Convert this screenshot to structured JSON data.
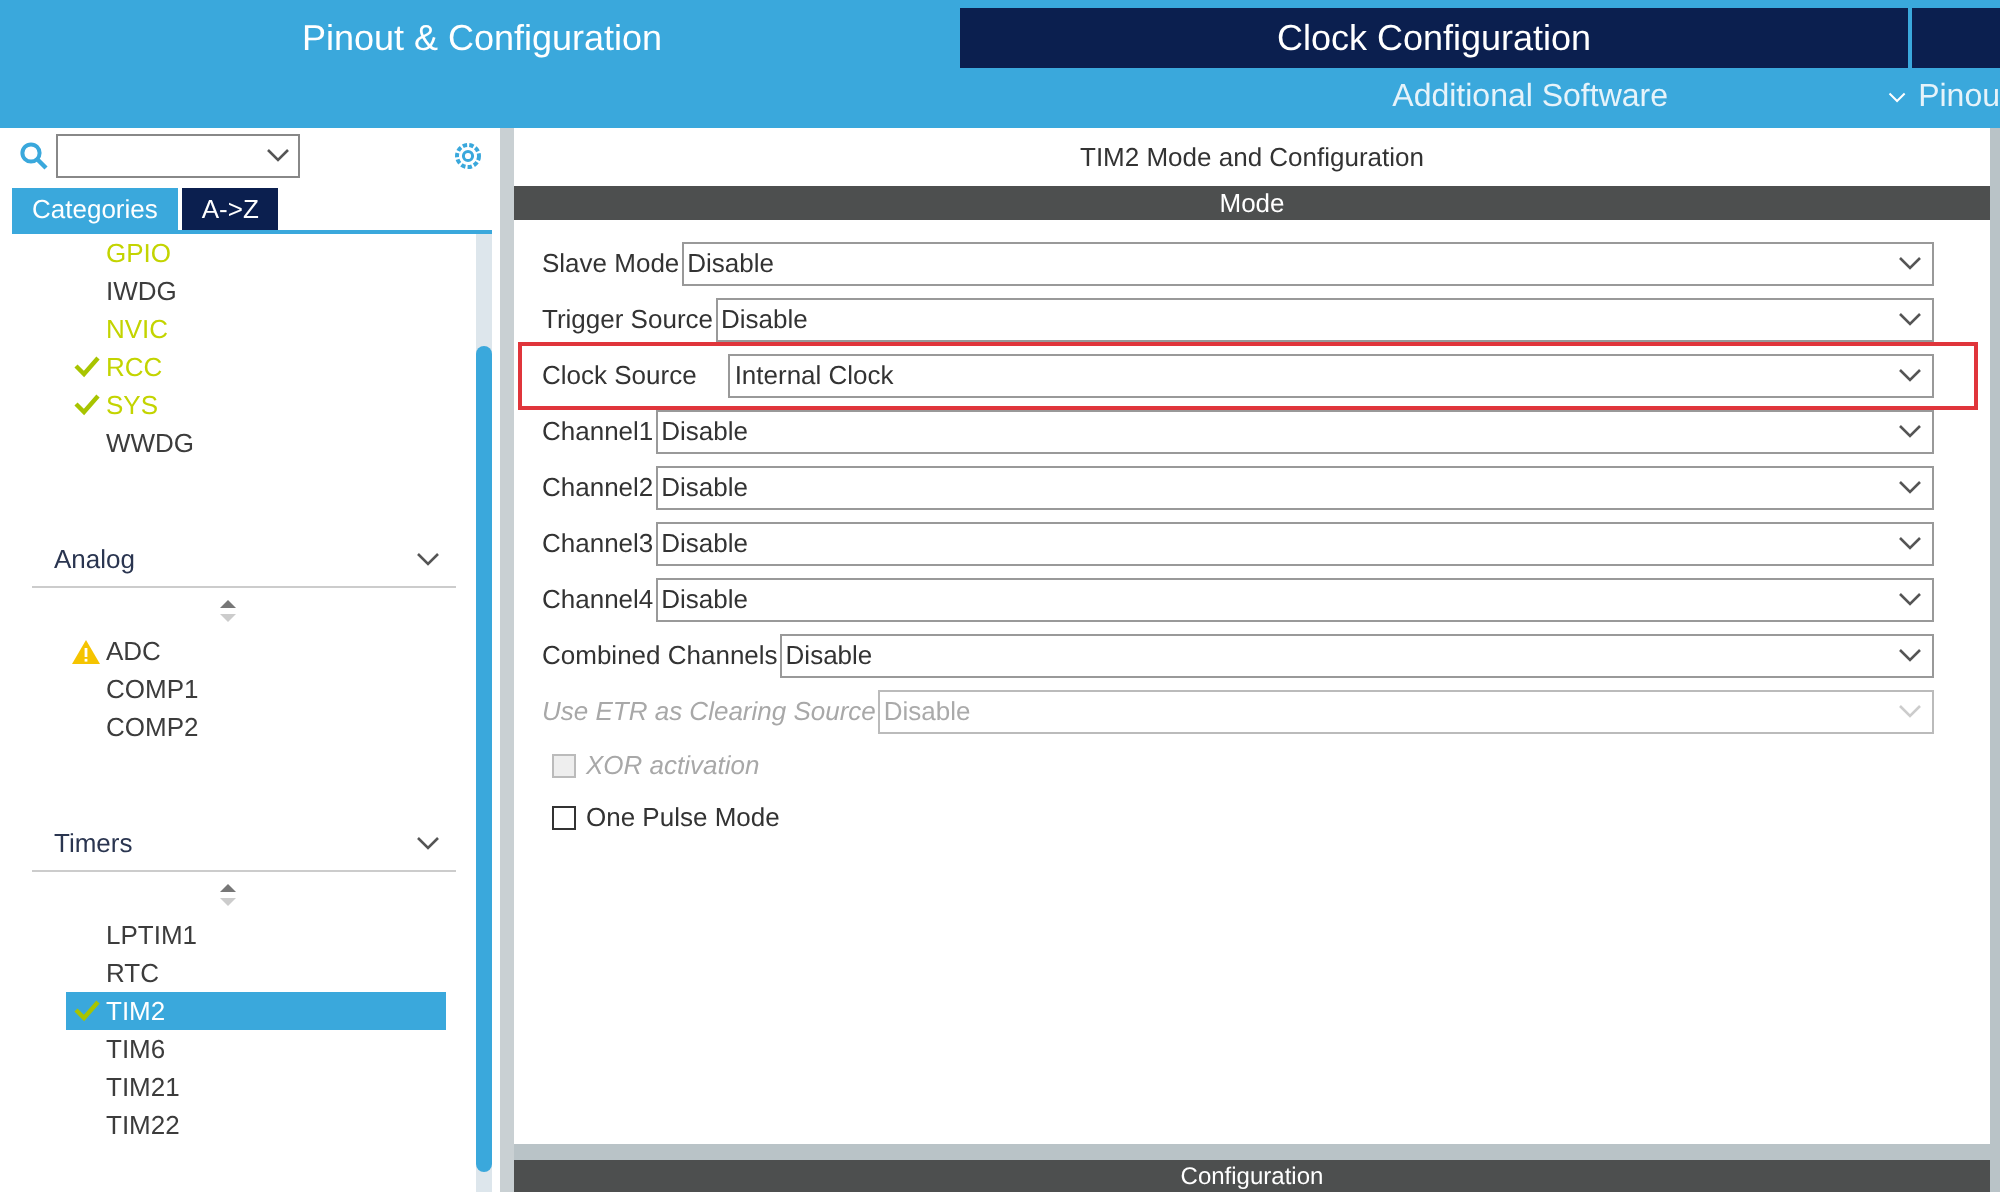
{
  "header": {
    "tabs": [
      {
        "label": "Pinout & Configuration",
        "selected": true
      },
      {
        "label": "Clock Configuration",
        "selected": false
      }
    ],
    "menus": [
      {
        "label": "Additional Software",
        "expandable": false
      },
      {
        "label": "Pinou",
        "expandable": true
      }
    ]
  },
  "sidebar": {
    "tabs": [
      {
        "label": "Categories",
        "selected": true
      },
      {
        "label": "A->Z",
        "selected": false
      }
    ],
    "groups": [
      {
        "items": [
          {
            "label": "GPIO",
            "active": true,
            "kind": "plain",
            "selected": false
          },
          {
            "label": "IWDG",
            "active": false,
            "kind": "plain",
            "selected": false
          },
          {
            "label": "NVIC",
            "active": true,
            "kind": "plain",
            "selected": false
          },
          {
            "label": "RCC",
            "active": true,
            "kind": "checked",
            "selected": false
          },
          {
            "label": "SYS",
            "active": true,
            "kind": "checked",
            "selected": false
          },
          {
            "label": "WWDG",
            "active": false,
            "kind": "plain",
            "selected": false
          }
        ]
      },
      {
        "title": "Analog",
        "expanded": true,
        "items": [
          {
            "label": "ADC",
            "active": false,
            "kind": "warning",
            "selected": false
          },
          {
            "label": "COMP1",
            "active": false,
            "kind": "plain",
            "selected": false
          },
          {
            "label": "COMP2",
            "active": false,
            "kind": "plain",
            "selected": false
          }
        ]
      },
      {
        "title": "Timers",
        "expanded": true,
        "items": [
          {
            "label": "LPTIM1",
            "active": false,
            "kind": "plain",
            "selected": false
          },
          {
            "label": "RTC",
            "active": false,
            "kind": "plain",
            "selected": false
          },
          {
            "label": "TIM2",
            "active": false,
            "kind": "checked",
            "selected": true
          },
          {
            "label": "TIM6",
            "active": false,
            "kind": "plain",
            "selected": false
          },
          {
            "label": "TIM21",
            "active": false,
            "kind": "plain",
            "selected": false
          },
          {
            "label": "TIM22",
            "active": false,
            "kind": "plain",
            "selected": false
          }
        ]
      }
    ]
  },
  "panel": {
    "title": "TIM2 Mode and Configuration",
    "mode_bar": "Mode",
    "config_bar": "Configuration",
    "fields": [
      {
        "kind": "select",
        "label": "Slave Mode",
        "value": "Disable",
        "disabled": false,
        "highlighted": false
      },
      {
        "kind": "select",
        "label": "Trigger Source",
        "value": "Disable",
        "disabled": false,
        "highlighted": false
      },
      {
        "kind": "select",
        "label": "Clock Source",
        "value": "Internal Clock",
        "disabled": false,
        "highlighted": true
      },
      {
        "kind": "select",
        "label": "Channel1",
        "value": "Disable",
        "disabled": false,
        "highlighted": false
      },
      {
        "kind": "select",
        "label": "Channel2",
        "value": "Disable",
        "disabled": false,
        "highlighted": false
      },
      {
        "kind": "select",
        "label": "Channel3",
        "value": "Disable",
        "disabled": false,
        "highlighted": false
      },
      {
        "kind": "select",
        "label": "Channel4",
        "value": "Disable",
        "disabled": false,
        "highlighted": false
      },
      {
        "kind": "select",
        "label": "Combined Channels",
        "value": "Disable",
        "disabled": false,
        "highlighted": false
      },
      {
        "kind": "select",
        "label": "Use ETR as Clearing Source",
        "value": "Disable",
        "disabled": true,
        "highlighted": false
      },
      {
        "kind": "checkbox",
        "label": "XOR activation",
        "checked": false,
        "disabled": true
      },
      {
        "kind": "checkbox",
        "label": "One Pulse Mode",
        "checked": false,
        "disabled": false
      }
    ]
  }
}
